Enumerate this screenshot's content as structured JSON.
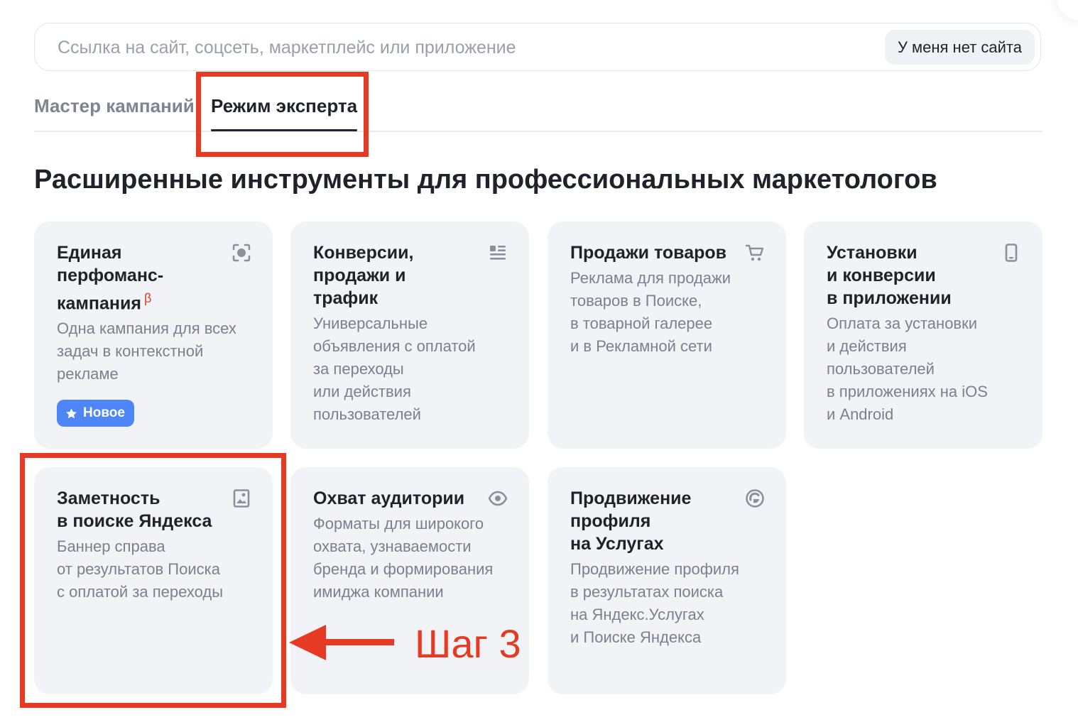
{
  "search": {
    "placeholder": "Ссылка на сайт, соцсеть, маркетплейс или приложение",
    "no_site_button": "У меня нет сайта"
  },
  "tabs": [
    {
      "label": "Мастер кампаний",
      "active": false
    },
    {
      "label": "Режим эксперта",
      "active": true
    }
  ],
  "section_title": "Расширенные инструменты для профессиональных маркетологов",
  "cards": [
    {
      "title": "Единая\nперфоманс-\nкампания",
      "beta": "β",
      "description": "Одна кампания для всех\nзадач в контекстной\nрекламе",
      "badge": "Новое",
      "icon": "target-icon"
    },
    {
      "title": "Конверсии,\nпродажи и трафик",
      "description": "Универсальные\nобъявления с оплатой\nза переходы\nили действия\nпользователей",
      "icon": "list-icon"
    },
    {
      "title": "Продажи товаров",
      "description": "Реклама для продажи\nтоваров в Поиске,\nв товарной галерее\nи в Рекламной сети",
      "icon": "cart-icon"
    },
    {
      "title": "Установки\nи конверсии\nв приложении",
      "description": "Оплата за установки\nи действия\nпользователей\nв приложениях на iOS\nи Android",
      "icon": "phone-icon"
    },
    {
      "title": "Заметность\nв поиске Яндекса",
      "description": "Баннер справа\nот результатов Поиска\nс оплатой за переходы",
      "icon": "image-icon"
    },
    {
      "title": "Охват аудитории",
      "description": "Форматы для широкого\nохвата, узнаваемости\nбренда и формирования\nимиджа компании",
      "icon": "eye-icon"
    },
    {
      "title": "Продвижение\nпрофиля\nна Услугах",
      "description": "Продвижение профиля\nв результатах поиска\nна Яндекс.Услугах\nи Поиске Яндекса",
      "icon": "services-icon"
    }
  ],
  "annotation": {
    "label": "Шаг 3"
  },
  "colors": {
    "accent_red": "#e63a25",
    "badge_blue": "#4f86f7",
    "card_bg": "#f2f3f6"
  }
}
